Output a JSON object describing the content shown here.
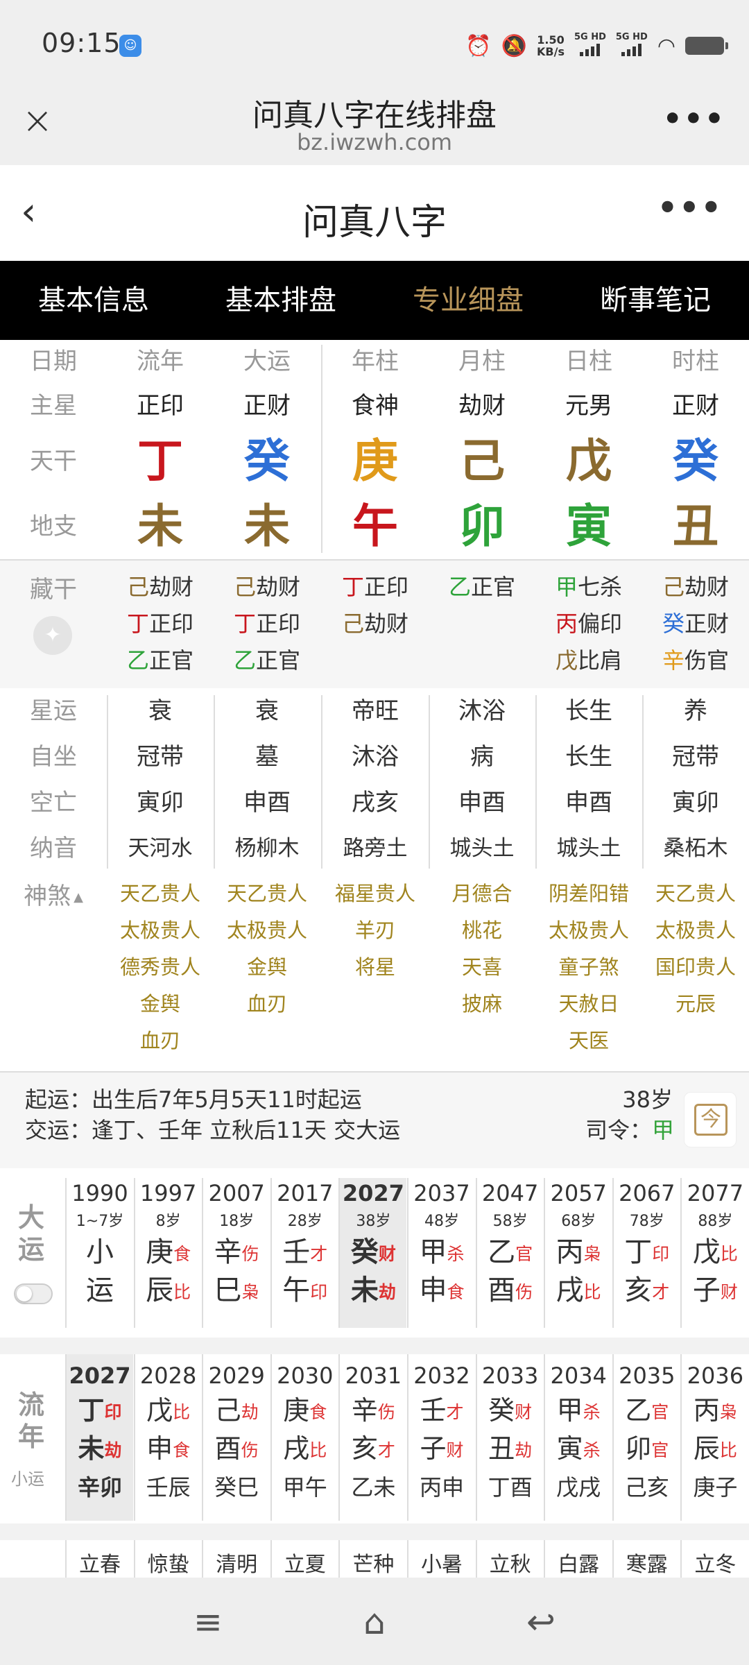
{
  "status": {
    "time": "09:15",
    "speed_top": "1.50",
    "speed_bottom": "KB/s",
    "sig1": "5G HD",
    "sig2": "5G HD"
  },
  "browser": {
    "title": "问真八字在线排盘",
    "url": "bz.iwzwh.com"
  },
  "page": {
    "title": "问真八字"
  },
  "tabs": [
    {
      "label": "基本信息",
      "active": false
    },
    {
      "label": "基本排盘",
      "active": false
    },
    {
      "label": "专业细盘",
      "active": true
    },
    {
      "label": "断事笔记",
      "active": false
    }
  ],
  "columns": [
    "流年",
    "大运",
    "年柱",
    "月柱",
    "日柱",
    "时柱"
  ],
  "row_labels": {
    "date": "日期",
    "zhuxing": "主星",
    "tiangan": "天干",
    "dizhi": "地支",
    "canggan": "藏干",
    "xingyun": "星运",
    "zizuo": "自坐",
    "kongwang": "空亡",
    "nayin": "纳音",
    "shensha": "神煞"
  },
  "zhuxing": [
    "正印",
    "正财",
    "食神",
    "劫财",
    "元男",
    "正财"
  ],
  "tiangan": [
    {
      "char": "丁",
      "color": "#c8161d"
    },
    {
      "char": "癸",
      "color": "#2d6fd6"
    },
    {
      "char": "庚",
      "color": "#e09a1a"
    },
    {
      "char": "己",
      "color": "#8a6a2f"
    },
    {
      "char": "戊",
      "color": "#8a6a2f"
    },
    {
      "char": "癸",
      "color": "#2d6fd6"
    }
  ],
  "dizhi": [
    {
      "char": "未",
      "color": "#8a6a2f"
    },
    {
      "char": "未",
      "color": "#8a6a2f"
    },
    {
      "char": "午",
      "color": "#c8161d"
    },
    {
      "char": "卯",
      "color": "#2ea33a"
    },
    {
      "char": "寅",
      "color": "#2ea33a"
    },
    {
      "char": "丑",
      "color": "#8a6a2f"
    }
  ],
  "canggan": [
    [
      {
        "g": "己",
        "c": "#8a6a2f",
        "s": "劫财"
      },
      {
        "g": "丁",
        "c": "#c8161d",
        "s": "正印"
      },
      {
        "g": "乙",
        "c": "#2ea33a",
        "s": "正官"
      }
    ],
    [
      {
        "g": "己",
        "c": "#8a6a2f",
        "s": "劫财"
      },
      {
        "g": "丁",
        "c": "#c8161d",
        "s": "正印"
      },
      {
        "g": "乙",
        "c": "#2ea33a",
        "s": "正官"
      }
    ],
    [
      {
        "g": "丁",
        "c": "#c8161d",
        "s": "正印"
      },
      {
        "g": "己",
        "c": "#8a6a2f",
        "s": "劫财"
      }
    ],
    [
      {
        "g": "乙",
        "c": "#2ea33a",
        "s": "正官"
      }
    ],
    [
      {
        "g": "甲",
        "c": "#2ea33a",
        "s": "七杀"
      },
      {
        "g": "丙",
        "c": "#c8161d",
        "s": "偏印"
      },
      {
        "g": "戊",
        "c": "#8a6a2f",
        "s": "比肩"
      }
    ],
    [
      {
        "g": "己",
        "c": "#8a6a2f",
        "s": "劫财"
      },
      {
        "g": "癸",
        "c": "#2d6fd6",
        "s": "正财"
      },
      {
        "g": "辛",
        "c": "#e09a1a",
        "s": "伤官"
      }
    ]
  ],
  "xingyun": [
    "衰",
    "衰",
    "帝旺",
    "沐浴",
    "长生",
    "养"
  ],
  "zizuo": [
    "冠带",
    "墓",
    "沐浴",
    "病",
    "长生",
    "冠带"
  ],
  "kongwang": [
    "寅卯",
    "申酉",
    "戌亥",
    "申酉",
    "申酉",
    "寅卯"
  ],
  "nayin": [
    "天河水",
    "杨柳木",
    "路旁土",
    "城头土",
    "城头土",
    "桑柘木"
  ],
  "shensha": [
    [
      "天乙贵人",
      "太极贵人",
      "德秀贵人",
      "金舆",
      "血刃"
    ],
    [
      "天乙贵人",
      "太极贵人",
      "金舆",
      "血刃"
    ],
    [
      "福星贵人",
      "羊刃",
      "将星"
    ],
    [
      "月德合",
      "桃花",
      "天喜",
      "披麻"
    ],
    [
      "阴差阳错",
      "太极贵人",
      "童子煞",
      "天赦日",
      "天医"
    ],
    [
      "天乙贵人",
      "太极贵人",
      "国印贵人",
      "元辰"
    ]
  ],
  "info": {
    "qiyun": "起运：出生后7年5月5天11时起运",
    "jiaoyun": "交运：逢丁、壬年 立秋后11天 交大运",
    "age": "38岁",
    "siling_label": "司令：",
    "siling_value": "甲",
    "calendar_char": "今"
  },
  "dayun": {
    "label": "大运",
    "items": [
      {
        "year": "1990",
        "age": "1~7岁",
        "g": "小",
        "gs": "",
        "z": "运",
        "zs": ""
      },
      {
        "year": "1997",
        "age": "8岁",
        "g": "庚",
        "gs": "食",
        "z": "辰",
        "zs": "比"
      },
      {
        "year": "2007",
        "age": "18岁",
        "g": "辛",
        "gs": "伤",
        "z": "巳",
        "zs": "枭"
      },
      {
        "year": "2017",
        "age": "28岁",
        "g": "壬",
        "gs": "才",
        "z": "午",
        "zs": "印"
      },
      {
        "year": "2027",
        "age": "38岁",
        "g": "癸",
        "gs": "财",
        "z": "未",
        "zs": "劫",
        "current": true
      },
      {
        "year": "2037",
        "age": "48岁",
        "g": "甲",
        "gs": "杀",
        "z": "申",
        "zs": "食"
      },
      {
        "year": "2047",
        "age": "58岁",
        "g": "乙",
        "gs": "官",
        "z": "酉",
        "zs": "伤"
      },
      {
        "year": "2057",
        "age": "68岁",
        "g": "丙",
        "gs": "枭",
        "z": "戌",
        "zs": "比"
      },
      {
        "year": "2067",
        "age": "78岁",
        "g": "丁",
        "gs": "印",
        "z": "亥",
        "zs": "才"
      },
      {
        "year": "2077",
        "age": "88岁",
        "g": "戊",
        "gs": "比",
        "z": "子",
        "zs": "财"
      }
    ]
  },
  "liunian": {
    "label": "流年",
    "sublabel": "小运",
    "items": [
      {
        "year": "2027",
        "g": "丁",
        "gs": "印",
        "z": "未",
        "zs": "劫",
        "xy": "辛卯",
        "current": true
      },
      {
        "year": "2028",
        "g": "戊",
        "gs": "比",
        "z": "申",
        "zs": "食",
        "xy": "壬辰"
      },
      {
        "year": "2029",
        "g": "己",
        "gs": "劫",
        "z": "酉",
        "zs": "伤",
        "xy": "癸巳"
      },
      {
        "year": "2030",
        "g": "庚",
        "gs": "食",
        "z": "戌",
        "zs": "比",
        "xy": "甲午"
      },
      {
        "year": "2031",
        "g": "辛",
        "gs": "伤",
        "z": "亥",
        "zs": "才",
        "xy": "乙未"
      },
      {
        "year": "2032",
        "g": "壬",
        "gs": "才",
        "z": "子",
        "zs": "财",
        "xy": "丙申"
      },
      {
        "year": "2033",
        "g": "癸",
        "gs": "财",
        "z": "丑",
        "zs": "劫",
        "xy": "丁酉"
      },
      {
        "year": "2034",
        "g": "甲",
        "gs": "杀",
        "z": "寅",
        "zs": "杀",
        "xy": "戊戌"
      },
      {
        "year": "2035",
        "g": "乙",
        "gs": "官",
        "z": "卯",
        "zs": "官",
        "xy": "己亥"
      },
      {
        "year": "2036",
        "g": "丙",
        "gs": "枭",
        "z": "辰",
        "zs": "比",
        "xy": "庚子"
      }
    ]
  },
  "jieqi": [
    "立春",
    "惊蛰",
    "清明",
    "立夏",
    "芒种",
    "小暑",
    "立秋",
    "白露",
    "寒露",
    "立冬"
  ]
}
